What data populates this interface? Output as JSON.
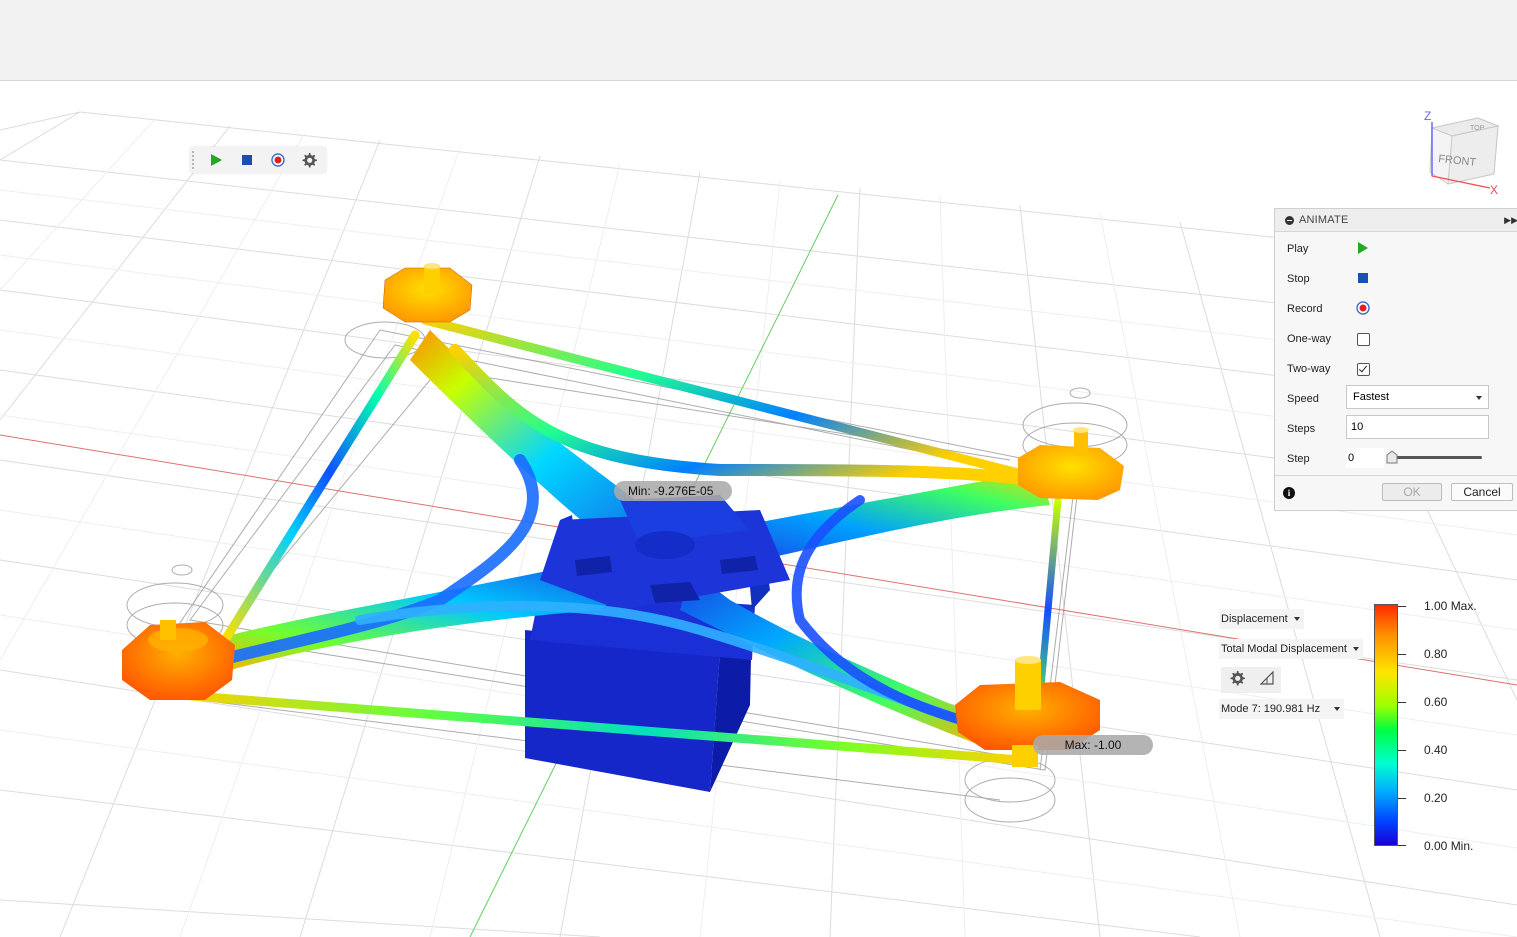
{
  "animate_panel": {
    "title": "ANIMATE",
    "rows": {
      "play": "Play",
      "stop": "Stop",
      "record": "Record",
      "one_way": "One-way",
      "two_way": "Two-way",
      "speed": "Speed",
      "steps": "Steps",
      "step": "Step"
    },
    "one_way_checked": false,
    "two_way_checked": true,
    "speed_value": "Fastest",
    "steps_value": "10",
    "step_value": "0",
    "ok_label": "OK",
    "cancel_label": "Cancel"
  },
  "results": {
    "type_dropdown": "Displacement",
    "component_dropdown": "Total Modal Displacement",
    "mode_dropdown": "Mode 7: 190.981 Hz"
  },
  "legend": {
    "labels": [
      "1.00 Max.",
      "0.80",
      "0.60",
      "0.40",
      "0.20",
      "0.00 Min."
    ]
  },
  "probes": {
    "min_label": "Min: -9.276E-05",
    "max_label": "Max: -1.00"
  },
  "viewcube": {
    "face_front": "FRONT",
    "face_top": "TOP",
    "axis_z": "Z",
    "axis_x": "X"
  },
  "colors": {
    "play_green": "#22a822",
    "stop_blue": "#1a4fb3",
    "record_red": "#e02020",
    "frame_blue": "#1438d6"
  }
}
